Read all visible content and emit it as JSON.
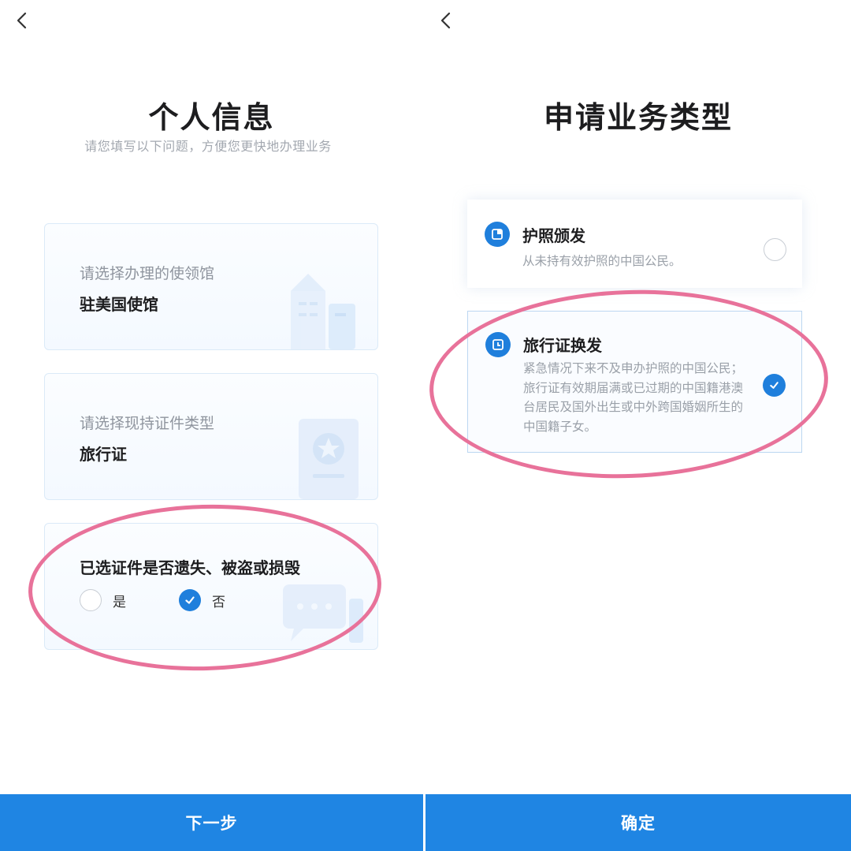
{
  "left_screen": {
    "title": "个人信息",
    "subtitle": "请您填写以下问题，方便您更快地办理业务",
    "embassy_card": {
      "label": "请选择办理的使领馆",
      "value": "驻美国使馆"
    },
    "document_card": {
      "label": "请选择现持证件类型",
      "value": "旅行证"
    },
    "lost_card": {
      "question": "已选证件是否遗失、被盗或损毁",
      "options": [
        {
          "label": "是",
          "selected": false
        },
        {
          "label": "否",
          "selected": true
        }
      ]
    },
    "next_button": "下一步"
  },
  "right_screen": {
    "title": "申请业务类型",
    "options": [
      {
        "title": "护照颁发",
        "description": "从未持有效护照的中国公民。",
        "selected": false
      },
      {
        "title": "旅行证换发",
        "description": "紧急情况下来不及申办护照的中国公民；旅行证有效期届满或已过期的中国籍港澳台居民及国外出生或中外跨国婚姻所生的中国籍子女。",
        "selected": true
      }
    ],
    "confirm_button": "确定"
  },
  "colors": {
    "accent": "#1f85e3",
    "highlight": "#e8729a",
    "muted_text": "#9aa0a8"
  },
  "icons": {
    "back": "chevron-left-icon",
    "check": "check-icon",
    "document": "document-icon"
  }
}
